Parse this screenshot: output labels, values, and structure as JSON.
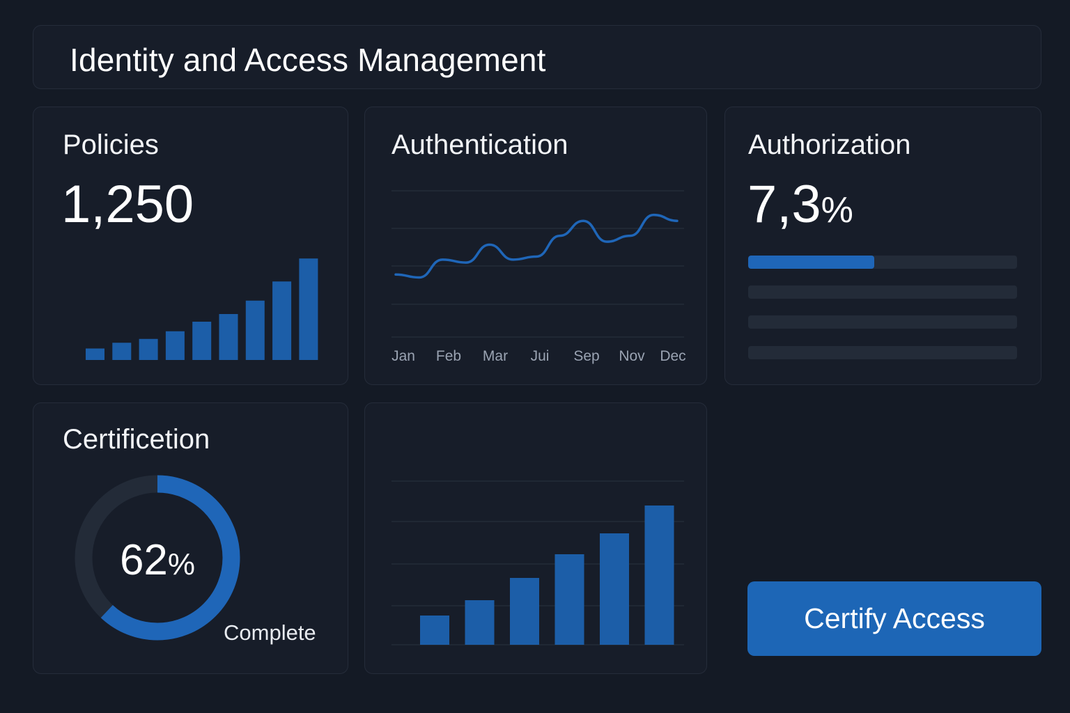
{
  "header": {
    "title": "Identity and Access Management"
  },
  "policies": {
    "title": "Policies",
    "value": "1,250",
    "chart_data": {
      "type": "bar",
      "values": [
        3,
        4.5,
        5.5,
        7.5,
        10,
        12,
        15.5,
        20.5,
        26.5
      ],
      "ylim": [
        0,
        30
      ]
    }
  },
  "authentication": {
    "title": "Authentication",
    "chart_data": {
      "type": "line",
      "x_labels": [
        "Jan",
        "Feb",
        "Mar",
        "Jui",
        "Sep",
        "Nov",
        "Dec"
      ],
      "values": [
        1.0,
        0.9,
        1.5,
        1.4,
        2.0,
        1.5,
        1.6,
        2.3,
        2.8,
        2.1,
        2.3,
        3.0,
        2.8
      ],
      "ylim": [
        0,
        4
      ],
      "grid": true
    }
  },
  "authorization": {
    "title": "Authorization",
    "value": "7,3",
    "suffix": "%",
    "bars": [
      0.47,
      0,
      0,
      0
    ]
  },
  "certification": {
    "title": "Certificetion",
    "percent_value": "62",
    "percent_suffix": "%",
    "progress": 0.62,
    "label": "Complete"
  },
  "bottom_chart": {
    "chart_data": {
      "type": "bar",
      "values": [
        2.1,
        3.2,
        4.8,
        6.5,
        8.0,
        10.0
      ],
      "ylim": [
        0,
        12
      ],
      "grid": true
    }
  },
  "actions": {
    "certify_label": "Certify Access"
  },
  "colors": {
    "accent": "#1f66b8",
    "bar": "#1c5ea8",
    "track": "#232b38",
    "background": "#141a25"
  }
}
